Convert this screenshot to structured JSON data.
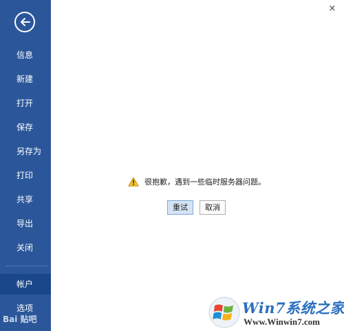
{
  "sidebar": {
    "items": [
      {
        "label": "信息"
      },
      {
        "label": "新建"
      },
      {
        "label": "打开"
      },
      {
        "label": "保存"
      },
      {
        "label": "另存为"
      },
      {
        "label": "打印"
      },
      {
        "label": "共享"
      },
      {
        "label": "导出"
      },
      {
        "label": "关闭"
      },
      {
        "label": "帐户"
      },
      {
        "label": "选项"
      }
    ],
    "active_item": "帐户"
  },
  "window": {
    "close_glyph": "×"
  },
  "main": {
    "message": "很抱歉，遇到一些临时服务器问题。",
    "retry_label": "重试",
    "cancel_label": "取消"
  },
  "watermarks": {
    "baidu_text": "Bai 贴吧",
    "site_name": "Win7系统之家",
    "site_url": "Www.Winwin7.com"
  },
  "colors": {
    "sidebar_bg": "#2b579a",
    "active_item_bg": "#19478a",
    "warning": "#f2c12e"
  }
}
